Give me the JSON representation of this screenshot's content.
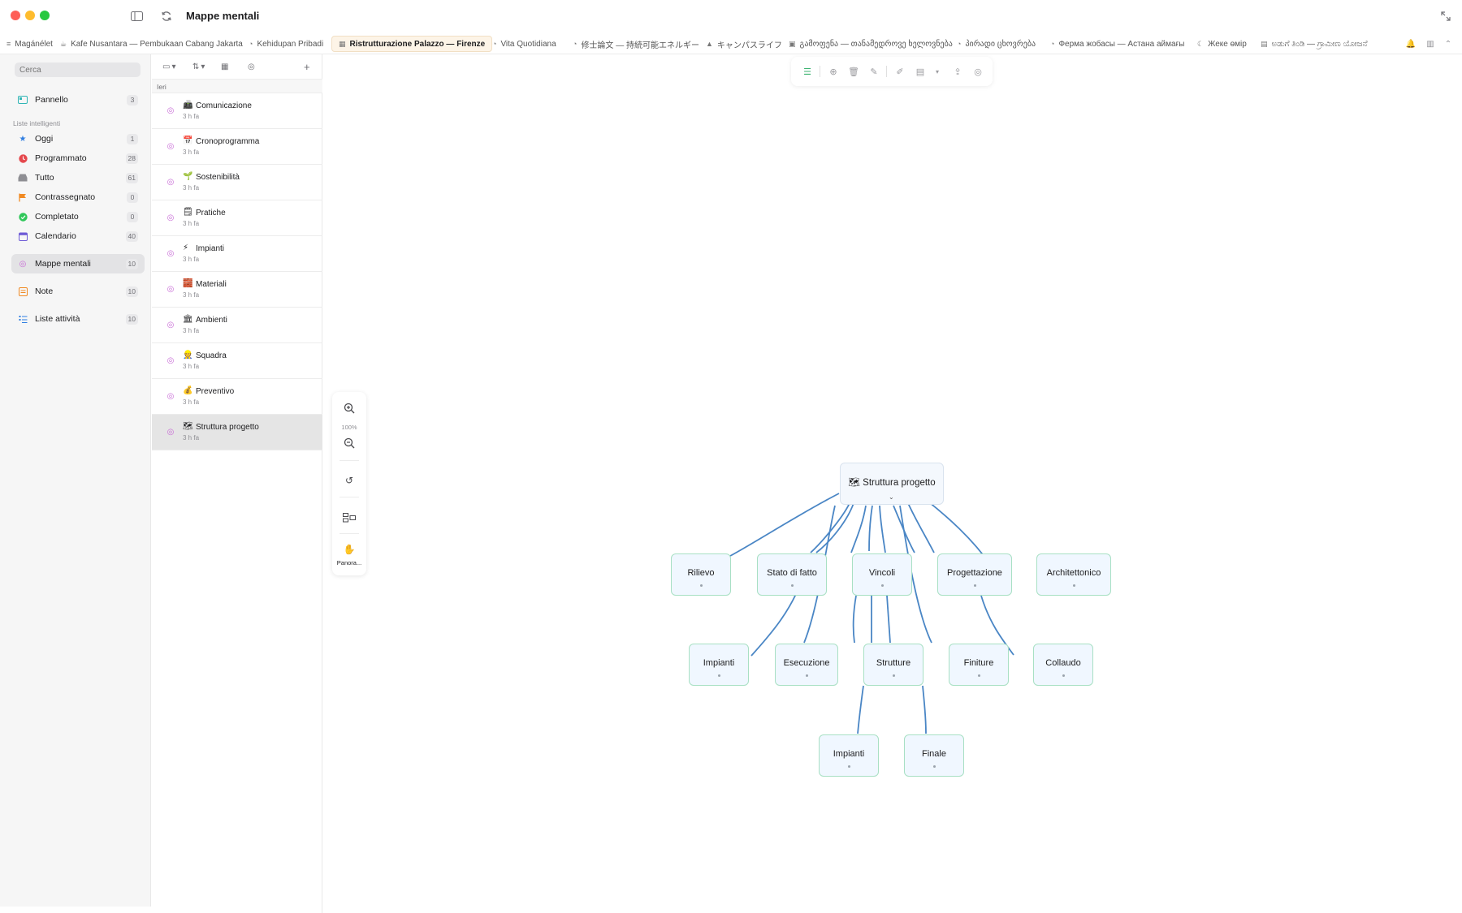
{
  "window": {
    "title": "Mappe mentali"
  },
  "tabs": [
    {
      "label": "Magánélet",
      "icon": "list-icon",
      "active": false
    },
    {
      "label": "Kafe Nusantara — Pembukaan Cabang Jakarta",
      "icon": "cup-icon",
      "active": false
    },
    {
      "label": "Kehidupan Pribadi",
      "icon": "bubble-icon",
      "active": false
    },
    {
      "label": "Ristrutturazione Palazzo — Firenze",
      "icon": "building-icon",
      "active": true
    },
    {
      "label": "Vita Quotidiana",
      "icon": "bubble-icon",
      "active": false
    },
    {
      "label": "修士論文 — 持続可能エネルギー",
      "icon": "bubble-icon",
      "active": false
    },
    {
      "label": "キャンパスライフ",
      "icon": "cap-icon",
      "active": false
    },
    {
      "label": "გამოფენა — თანამედროვე ხელოვნება",
      "icon": "image-icon",
      "active": false
    },
    {
      "label": "პირადი ცხოვრება",
      "icon": "bubble-icon",
      "active": false
    },
    {
      "label": "Ферма жобасы — Астана аймағы",
      "icon": "bubble-icon",
      "active": false
    },
    {
      "label": "Жеке өмір",
      "icon": "moon-icon",
      "active": false
    },
    {
      "label": "ಅಡುಗೆ ತಿಂಡಿ — ಗ್ರಾಮೀಣ ಯೋಜನೆ",
      "icon": "book-icon",
      "active": false
    }
  ],
  "sidebar": {
    "search_placeholder": "Cerca",
    "dashboard": {
      "label": "Pannello",
      "count": "3"
    },
    "smart_lists_title": "Liste intelligenti",
    "smart_lists": [
      {
        "label": "Oggi",
        "count": "1",
        "icon": "star-icon",
        "color": "#2f7de1"
      },
      {
        "label": "Programmato",
        "count": "28",
        "icon": "clock-icon",
        "color": "#e5484d"
      },
      {
        "label": "Tutto",
        "count": "61",
        "icon": "tray-icon",
        "color": "#8e8e93"
      },
      {
        "label": "Contrassegnato",
        "count": "0",
        "icon": "flag-icon",
        "color": "#f08a24"
      },
      {
        "label": "Completato",
        "count": "0",
        "icon": "check-circle-icon",
        "color": "#30c75a"
      },
      {
        "label": "Calendario",
        "count": "40",
        "icon": "calendar-icon",
        "color": "#6e5bd6"
      }
    ],
    "mindmaps": {
      "label": "Mappe mentali",
      "count": "10"
    },
    "notes": {
      "label": "Note",
      "count": "10"
    },
    "tasklists": {
      "label": "Liste attività",
      "count": "10"
    }
  },
  "list": {
    "group_header": "Ieri",
    "items": [
      {
        "emoji": "�among",
        "title": "Comunicazione",
        "subtitle": "3 h fa"
      },
      {
        "emoji": "📅",
        "title": "Cronoprogramma",
        "subtitle": "3 h fa"
      },
      {
        "emoji": "🌱",
        "title": "Sostenibilità",
        "subtitle": "3 h fa"
      },
      {
        "emoji": "🗒",
        "title": "Pratiche",
        "subtitle": "3 h fa"
      },
      {
        "emoji": "⚡",
        "title": "Impianti",
        "subtitle": "3 h fa"
      },
      {
        "emoji": "🧱",
        "title": "Materiali",
        "subtitle": "3 h fa"
      },
      {
        "emoji": "🏛",
        "title": "Ambienti",
        "subtitle": "3 h fa"
      },
      {
        "emoji": "👷",
        "title": "Squadra",
        "subtitle": "3 h fa"
      },
      {
        "emoji": "💰",
        "title": "Preventivo",
        "subtitle": "3 h fa"
      },
      {
        "emoji": "🗺",
        "title": "Struttura progetto",
        "subtitle": "3 h fa"
      }
    ]
  },
  "zoom": {
    "level": "100%",
    "pan_label": "Panora..."
  },
  "mindmap": {
    "root": {
      "emoji": "🗺",
      "label": "Struttura progetto"
    },
    "nodes": [
      "Rilievo",
      "Stato di fatto",
      "Vincoli",
      "Progettazione",
      "Architettonico",
      "Impianti",
      "Esecuzione",
      "Strutture",
      "Finiture",
      "Collaudo",
      "Impianti",
      "Finale"
    ]
  },
  "colors": {
    "accent_mindmap": "#c86bd6",
    "edge": "#4a86c5",
    "node_border": "#a8e0c4",
    "node_fill": "#f0f7ff",
    "active_tab": "#fdf4e7"
  }
}
